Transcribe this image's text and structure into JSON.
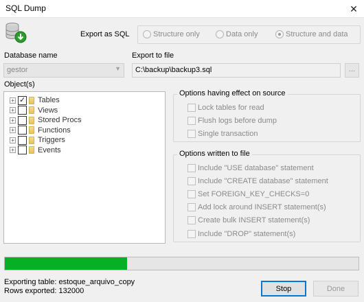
{
  "window": {
    "title": "SQL Dump",
    "close_glyph": "✕"
  },
  "export_mode": {
    "label": "Export as SQL",
    "options": [
      {
        "label": "Structure only",
        "selected": false
      },
      {
        "label": "Data only",
        "selected": false
      },
      {
        "label": "Structure and data",
        "selected": true
      }
    ]
  },
  "database": {
    "label": "Database name",
    "value": "gestor",
    "arrow": "▼"
  },
  "export_to": {
    "label": "Export to file",
    "value": "C:\\backup\\backup3.sql",
    "browse_label": "..."
  },
  "objects": {
    "label": "Object(s)",
    "expander": "+",
    "items": [
      {
        "label": "Tables",
        "checked": true
      },
      {
        "label": "Views",
        "checked": false
      },
      {
        "label": "Stored Procs",
        "checked": false
      },
      {
        "label": "Functions",
        "checked": false
      },
      {
        "label": "Triggers",
        "checked": false
      },
      {
        "label": "Events",
        "checked": false
      }
    ]
  },
  "source_options": {
    "title": "Options having effect on source",
    "items": [
      "Lock tables for read",
      "Flush logs before dump",
      "Single transaction"
    ]
  },
  "file_options": {
    "title": "Options written to file",
    "items": [
      "Include \"USE database\" statement",
      "Include \"CREATE database\" statement",
      "Set FOREIGN_KEY_CHECKS=0",
      "Add lock around INSERT statement(s)",
      "Create bulk INSERT statement(s)",
      "Include \"DROP\" statement(s)"
    ]
  },
  "progress": {
    "fraction": 0.345,
    "fill_color": "#06b025"
  },
  "status": {
    "exporting": "Exporting table: estoque_arquivo_copy",
    "rows": "Rows exported: 132000"
  },
  "buttons": {
    "stop": "Stop",
    "done": "Done"
  },
  "icons": {
    "app": "database-export-icon",
    "folder": "folder-icon"
  }
}
